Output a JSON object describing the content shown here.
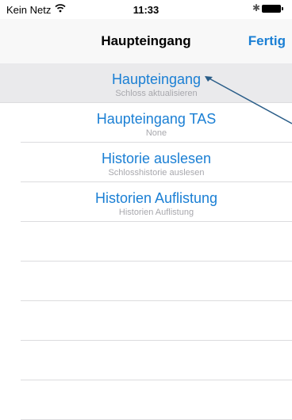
{
  "status_bar": {
    "carrier": "Kein Netz",
    "time": "11:33",
    "icons": [
      "wifi-icon",
      "bluetooth-icon",
      "battery-icon"
    ]
  },
  "nav": {
    "title": "Haupteingang",
    "done_label": "Fertig"
  },
  "rows": [
    {
      "title": "Haupteingang",
      "subtitle": "Schloss aktualisieren"
    },
    {
      "title": "Haupteingang TAS",
      "subtitle": "None"
    },
    {
      "title": "Historie auslesen",
      "subtitle": "Schlosshistorie auslesen"
    },
    {
      "title": "Historien Auflistung",
      "subtitle": "Historien Auflistung"
    }
  ],
  "colors": {
    "accent": "#1a7fd4",
    "subtitle": "#a8a8ad",
    "selected_row": "#eaeaec",
    "annotation_line": "#2a5d88"
  }
}
